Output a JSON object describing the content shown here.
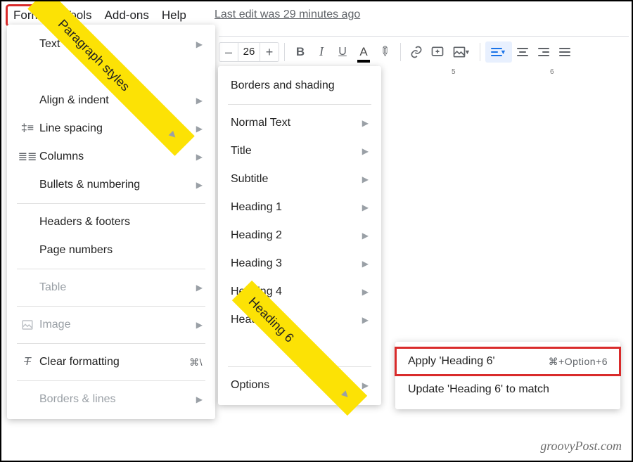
{
  "menubar": {
    "format": "Format",
    "tools": "Tools",
    "addons": "Add-ons",
    "help": "Help"
  },
  "last_edit": "Last edit was 29 minutes ago",
  "toolbar": {
    "minus": "–",
    "plus": "+",
    "font_size": "26"
  },
  "menu1": {
    "text": "Text",
    "paragraph_styles": "Paragraph styles",
    "align_indent": "Align & indent",
    "line_spacing": "Line spacing",
    "columns": "Columns",
    "bullets_numbering": "Bullets & numbering",
    "headers_footers": "Headers & footers",
    "page_numbers": "Page numbers",
    "table": "Table",
    "image": "Image",
    "clear_formatting": "Clear formatting",
    "clear_formatting_sc": "⌘\\",
    "borders_lines": "Borders & lines"
  },
  "menu2": {
    "borders_shading": "Borders and shading",
    "normal_text": "Normal Text",
    "title": "Title",
    "subtitle": "Subtitle",
    "h1": "Heading 1",
    "h2": "Heading 2",
    "h3": "Heading 3",
    "h4": "Heading 4",
    "h5": "Heading 5",
    "h6": "Heading 6",
    "options": "Options"
  },
  "menu3": {
    "apply": "Apply 'Heading 6'",
    "apply_sc": "⌘+Option+6",
    "update": "Update 'Heading 6' to match"
  },
  "ruler": {
    "t5": "5",
    "t6": "6"
  },
  "watermark": "groovyPost.com"
}
